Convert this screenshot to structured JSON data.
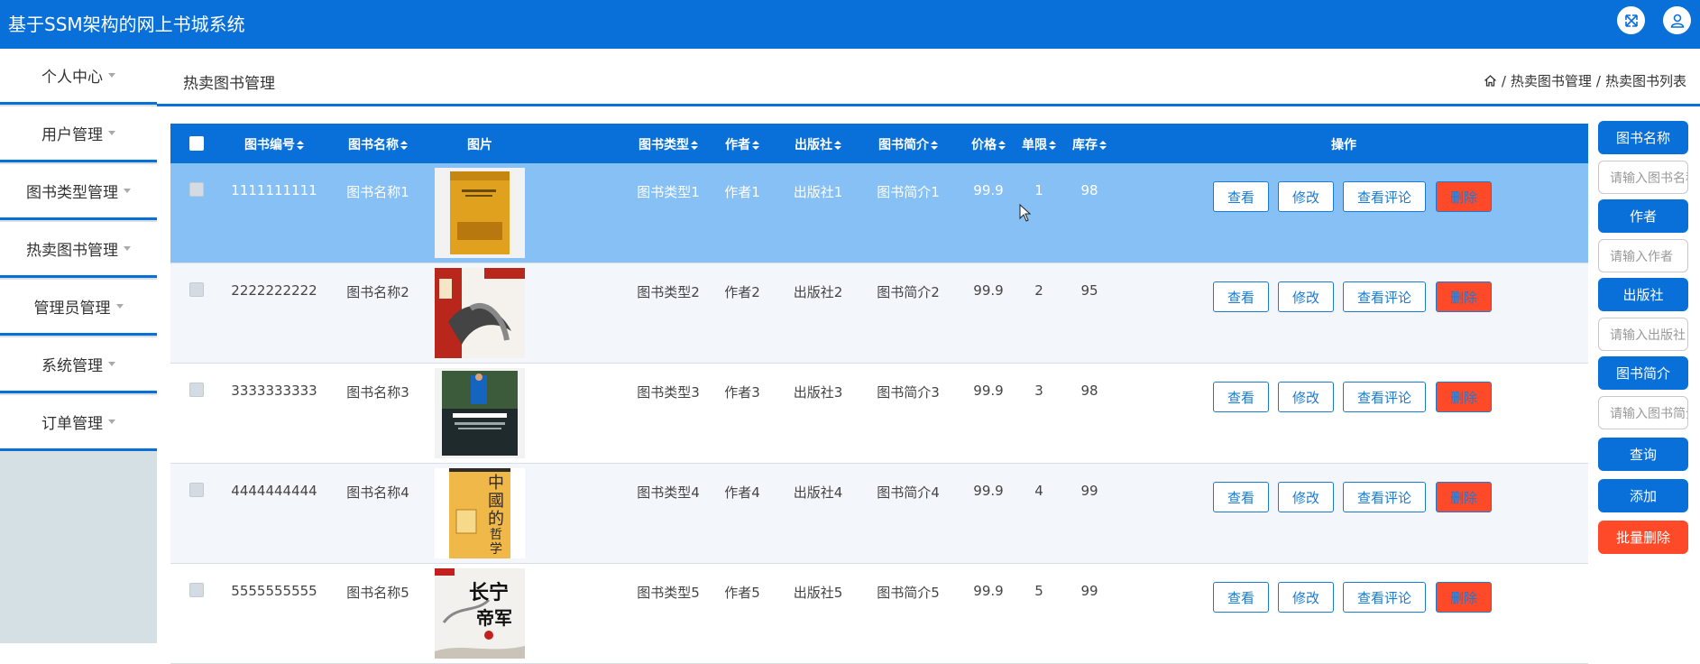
{
  "app_title": "基于SSM架构的网上书城系统",
  "header_icons": [
    "fullscreen-icon",
    "user-icon"
  ],
  "colors": {
    "primary": "#0a70d9",
    "danger": "#ff4a2a",
    "selected_row": "#86c0f4",
    "sidebar_bg": "#d4e0e3"
  },
  "sidebar": {
    "items": [
      {
        "label": "个人中心"
      },
      {
        "label": "用户管理"
      },
      {
        "label": "图书类型管理"
      },
      {
        "label": "热卖图书管理"
      },
      {
        "label": "管理员管理"
      },
      {
        "label": "系统管理"
      },
      {
        "label": "订单管理"
      }
    ]
  },
  "page": {
    "heading": "热卖图书管理",
    "breadcrumb": [
      "热卖图书管理",
      "热卖图书列表"
    ],
    "breadcrumb_sep": "/"
  },
  "table": {
    "columns": [
      "图书编号",
      "图书名称",
      "图片",
      "图书类型",
      "作者",
      "出版社",
      "图书简介",
      "价格",
      "单限",
      "库存",
      "操作"
    ],
    "sortable": [
      true,
      true,
      false,
      true,
      true,
      true,
      true,
      true,
      true,
      true,
      false
    ],
    "actions": {
      "view": "查看",
      "edit": "修改",
      "comments": "查看评论",
      "delete": "删除"
    },
    "rows": [
      {
        "id": "1111111111",
        "name": "图书名称1",
        "type": "图书类型1",
        "author": "作者1",
        "publisher": "出版社1",
        "intro": "图书简介1",
        "price": "99.9",
        "limit": "1",
        "stock": "98",
        "selected": true
      },
      {
        "id": "2222222222",
        "name": "图书名称2",
        "type": "图书类型2",
        "author": "作者2",
        "publisher": "出版社2",
        "intro": "图书简介2",
        "price": "99.9",
        "limit": "2",
        "stock": "95"
      },
      {
        "id": "3333333333",
        "name": "图书名称3",
        "type": "图书类型3",
        "author": "作者3",
        "publisher": "出版社3",
        "intro": "图书简介3",
        "price": "99.9",
        "limit": "3",
        "stock": "98"
      },
      {
        "id": "4444444444",
        "name": "图书名称4",
        "type": "图书类型4",
        "author": "作者4",
        "publisher": "出版社4",
        "intro": "图书简介4",
        "price": "99.9",
        "limit": "4",
        "stock": "99"
      },
      {
        "id": "5555555555",
        "name": "图书名称5",
        "type": "图书类型5",
        "author": "作者5",
        "publisher": "出版社5",
        "intro": "图书简介5",
        "price": "99.9",
        "limit": "5",
        "stock": "99"
      }
    ]
  },
  "cover_texts": {
    "cover4": "中國的哲學",
    "cover5": "长宁帝军"
  },
  "search": {
    "name_label": "图书名称",
    "name_placeholder": "请输入图书名称",
    "author_label": "作者",
    "author_placeholder": "请输入作者",
    "publisher_label": "出版社",
    "publisher_placeholder": "请输入出版社",
    "intro_label": "图书简介",
    "intro_placeholder": "请输入图书简介",
    "query_button": "查询",
    "add_button": "添加",
    "batch_delete_button": "批量删除"
  }
}
